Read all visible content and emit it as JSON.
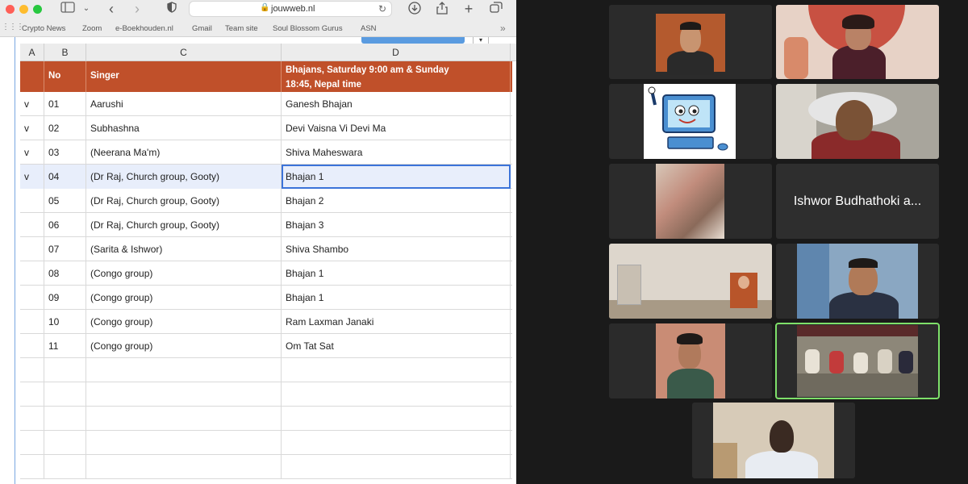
{
  "browser": {
    "url": "jouwweb.nl",
    "bookmarks": [
      "Crypto News",
      "Zoom",
      "e-Boekhouden.nl",
      "Gmail",
      "Team site",
      "Soul Blossom Gurus",
      "ASN"
    ]
  },
  "sheet": {
    "columns": [
      "A",
      "B",
      "C",
      "D"
    ],
    "header": {
      "no": "No",
      "singer": "Singer",
      "bhajans_line1": "Bhajans, Saturday 9:00 am & Sunday",
      "bhajans_line2": "18:45, Nepal time"
    },
    "rows": [
      {
        "mark": "v",
        "no": "01",
        "singer": "Aarushi",
        "bhajan": "Ganesh Bhajan"
      },
      {
        "mark": "v",
        "no": "02",
        "singer": "Subhashna",
        "bhajan": "Devi Vaisna Vi Devi Ma"
      },
      {
        "mark": "v",
        "no": "03",
        "singer": "(Neerana Ma'm)",
        "bhajan": "Shiva Maheswara"
      },
      {
        "mark": "v",
        "no": "04",
        "singer": "(Dr Raj, Church group, Gooty)",
        "bhajan": "Bhajan 1"
      },
      {
        "mark": "",
        "no": "05",
        "singer": "(Dr Raj, Church group, Gooty)",
        "bhajan": "Bhajan 2"
      },
      {
        "mark": "",
        "no": "06",
        "singer": "(Dr Raj, Church group, Gooty)",
        "bhajan": "Bhajan 3"
      },
      {
        "mark": "",
        "no": "07",
        "singer": "(Sarita & Ishwor)",
        "bhajan": "Shiva Shambo"
      },
      {
        "mark": "",
        "no": "08",
        "singer": "(Congo group)",
        "bhajan": "Bhajan 1"
      },
      {
        "mark": "",
        "no": "09",
        "singer": "(Congo group)",
        "bhajan": "Bhajan 1"
      },
      {
        "mark": "",
        "no": "10",
        "singer": "(Congo group)",
        "bhajan": "Ram Laxman Janaki"
      },
      {
        "mark": "",
        "no": "11",
        "singer": "(Congo group)",
        "bhajan": "Om Tat Sat"
      },
      {
        "mark": "",
        "no": "",
        "singer": "",
        "bhajan": ""
      },
      {
        "mark": "",
        "no": "",
        "singer": "",
        "bhajan": ""
      },
      {
        "mark": "",
        "no": "",
        "singer": "",
        "bhajan": ""
      },
      {
        "mark": "",
        "no": "",
        "singer": "",
        "bhajan": ""
      },
      {
        "mark": "",
        "no": "",
        "singer": "",
        "bhajan": ""
      }
    ],
    "selected_row": 3
  },
  "video": {
    "name_tile": "Ishwor Budhathoki a...",
    "colors": {
      "active_speaker": "#7ee06a",
      "header_fill": "#c0502a"
    }
  }
}
